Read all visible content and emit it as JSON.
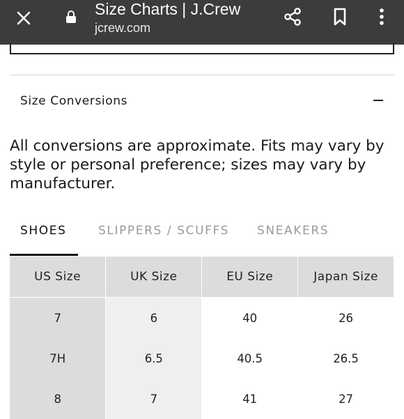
{
  "browser": {
    "title": "Size Charts | J.Crew",
    "url": "jcrew.com",
    "icons": [
      "close-icon",
      "lock-icon",
      "share-icon",
      "bookmark-icon",
      "more-vert-icon"
    ]
  },
  "section": {
    "title": "Size Conversions",
    "toggle_icon": "minus-icon",
    "note": "All conversions are approximate. Fits may vary by style or personal preference; sizes may vary by manufacturer."
  },
  "tabs": [
    {
      "label": "SHOES",
      "active": true
    },
    {
      "label": "SLIPPERS / SCUFFS",
      "active": false
    },
    {
      "label": "SNEAKERS",
      "active": false
    }
  ],
  "table": {
    "headers": [
      "US Size",
      "UK Size",
      "EU Size",
      "Japan Size"
    ],
    "rows": [
      [
        "7",
        "6",
        "40",
        "26"
      ],
      [
        "7H",
        "6.5",
        "40.5",
        "26.5"
      ],
      [
        "8",
        "7",
        "41",
        "27"
      ]
    ]
  },
  "colors": {
    "topbar": "#3c3c3c",
    "header_cell": "#dcdcdc",
    "second_col": "#efefef",
    "inactive_tab": "#9a9a9a"
  }
}
